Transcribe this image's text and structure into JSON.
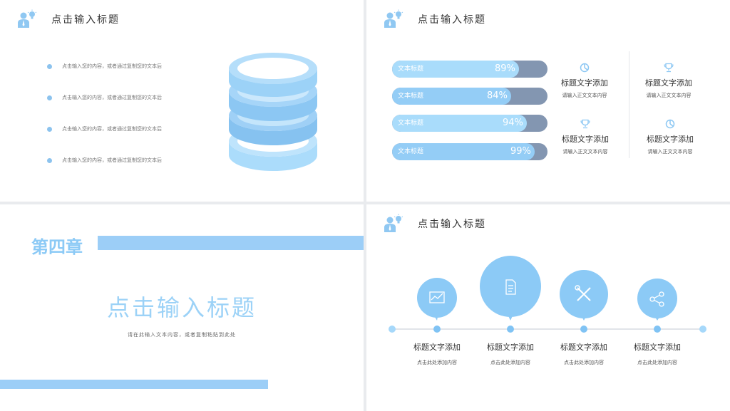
{
  "slide1": {
    "title": "点击输入标题",
    "bullets": [
      "点击输入您的内容，或者通过复制您的文本后",
      "点击输入您的内容，或者通过复制您的文本后",
      "点击输入您的内容，或者通过复制您的文本后",
      "点击输入您的内容，或者通过复制您的文本后"
    ]
  },
  "slide2": {
    "title": "点击输入标题",
    "bars": [
      {
        "label": "文本标题",
        "pct_text": "89%",
        "value": 89,
        "color": "#a9dcfb"
      },
      {
        "label": "文本标题",
        "pct_text": "84%",
        "value": 84,
        "color": "#94cdf6"
      },
      {
        "label": "文本标题",
        "pct_text": "94%",
        "value": 94,
        "color": "#a9dcfb"
      },
      {
        "label": "文本标题",
        "pct_text": "99%",
        "value": 99,
        "color": "#94cdf6"
      }
    ],
    "items": [
      {
        "icon": "chart-pie-icon",
        "title": "标题文字添加",
        "sub": "请输入正文文本内容"
      },
      {
        "icon": "trophy-icon",
        "title": "标题文字添加",
        "sub": "请输入正文文本内容"
      },
      {
        "icon": "trophy-icon",
        "title": "标题文字添加",
        "sub": "请输入正文文本内容"
      },
      {
        "icon": "chart-pie-icon",
        "title": "标题文字添加",
        "sub": "请输入正文文本内容"
      }
    ]
  },
  "slide3": {
    "chapter": "第四章",
    "title": "点击输入标题",
    "subtitle": "请在此输入文本内容，或者复制粘贴到此处"
  },
  "slide4": {
    "title": "点击输入标题",
    "items": [
      {
        "icon": "line-chart-icon",
        "title": "标题文字添加",
        "sub": "点击此处添加内容"
      },
      {
        "icon": "document-icon",
        "title": "标题文字添加",
        "sub": "点击此处添加内容"
      },
      {
        "icon": "tools-icon",
        "title": "标题文字添加",
        "sub": "点击此处添加内容"
      },
      {
        "icon": "share-icon",
        "title": "标题文字添加",
        "sub": "点击此处添加内容"
      }
    ]
  },
  "colors": {
    "accent": "#8ccaf6",
    "bar_track": "#8396b1",
    "dot": "#8cc3ee"
  }
}
